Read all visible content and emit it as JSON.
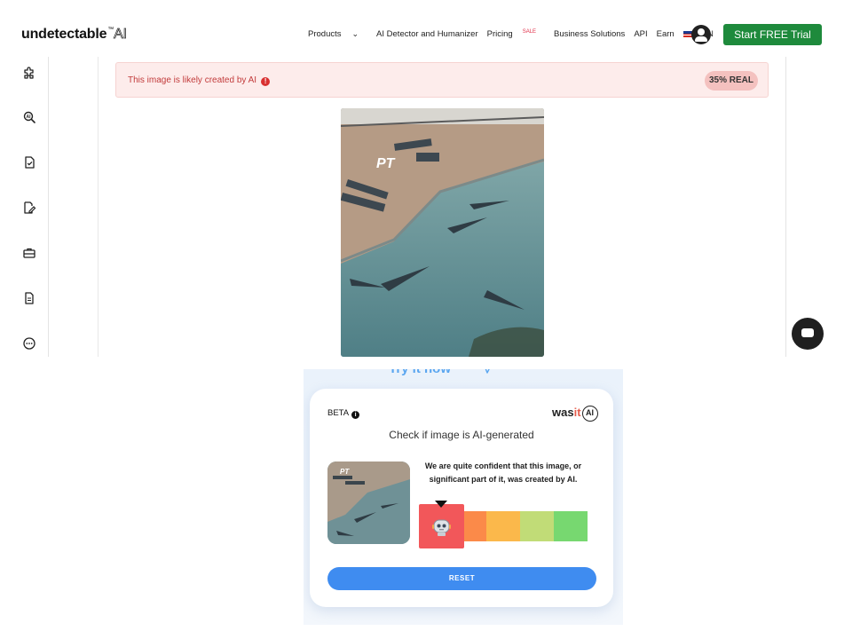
{
  "header": {
    "logo_main": "undetectable",
    "logo_tm": "™",
    "logo_ai": "AI",
    "nav": {
      "products": "Products",
      "detector": "AI Detector and Humanizer",
      "pricing": "Pricing",
      "sale": "SALE",
      "business": "Business Solutions",
      "api": "API",
      "earn": "Earn",
      "lang": "EN"
    },
    "cta": "Start FREE Trial"
  },
  "sidebar": {
    "items": [
      "puzzle-icon",
      "magnify-icon",
      "check-document-icon",
      "edit-document-icon",
      "briefcase-icon",
      "document-icon",
      "more-icon"
    ]
  },
  "result": {
    "message": "This image is likely created by AI",
    "message_icon": "!",
    "score": "35% REAL"
  },
  "image_watermark": "PT",
  "wasit": {
    "banner": "Try it now",
    "beta": "BETA",
    "beta_icon": "i",
    "logo_was": "was",
    "logo_it": "it",
    "logo_ai": "AI",
    "title": "Check if image is AI-generated",
    "verdict": "We are quite confident that this image, or significant part of it, was created by AI.",
    "scale_colors": [
      "#f2575a",
      "#fb8a49",
      "#fbb84b",
      "#c1dc77",
      "#77d870"
    ],
    "scale_selected_index": 0,
    "reset": "RESET"
  },
  "colors": {
    "brand_green": "#1e8a3c",
    "alert_red": "#c23b3b",
    "reset_blue": "#3f8cf0"
  }
}
